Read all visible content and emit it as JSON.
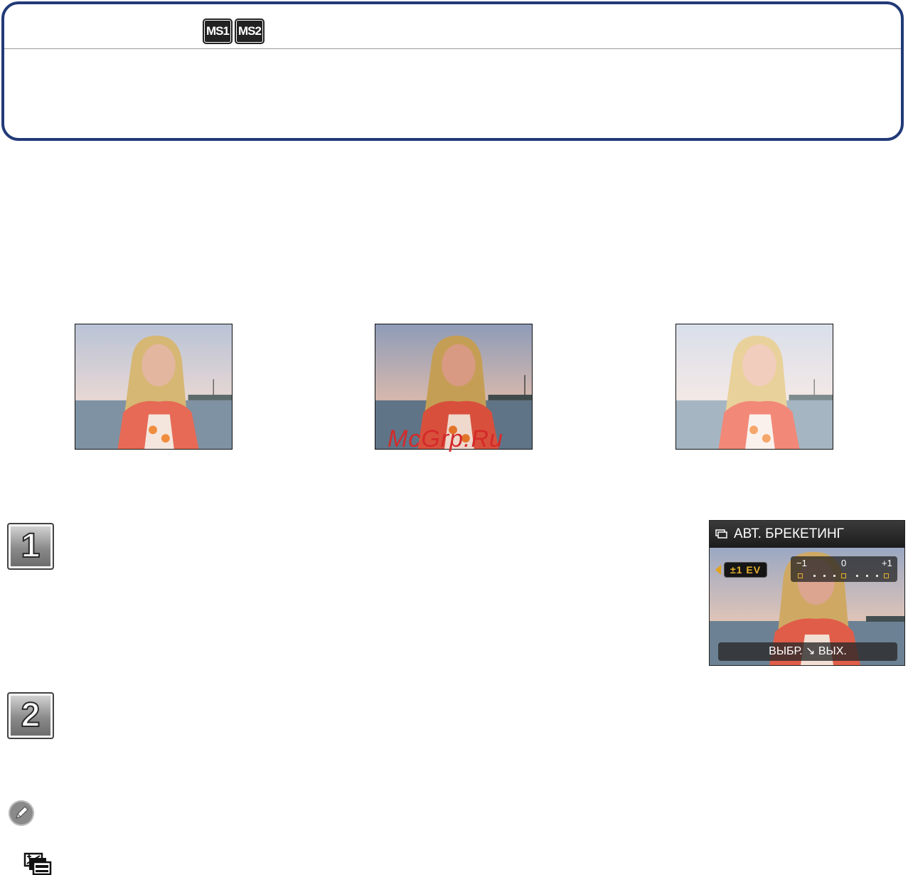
{
  "header": {
    "mode_icons": [
      "MS1",
      "MS2"
    ],
    "border_color": "#223a78"
  },
  "photos": [
    {
      "id": "photo-1",
      "icon": "portrait-photo"
    },
    {
      "id": "photo-2",
      "icon": "portrait-photo"
    },
    {
      "id": "photo-3",
      "icon": "portrait-photo"
    }
  ],
  "watermark": "McGrp.Ru",
  "steps": [
    {
      "number": "1"
    },
    {
      "number": "2"
    }
  ],
  "lcd": {
    "title": "АВТ. БРЕКЕТИНГ",
    "ev_value": "±1  EV",
    "scale": {
      "left": "−1",
      "center": "0",
      "right": "+1"
    },
    "bottom_bar": "ВЫБР. ↘ ВЫХ.",
    "accent_color": "#e6b130"
  },
  "icons": {
    "note": "pencil-note-icon",
    "bracket": "auto-bracket-icon"
  }
}
